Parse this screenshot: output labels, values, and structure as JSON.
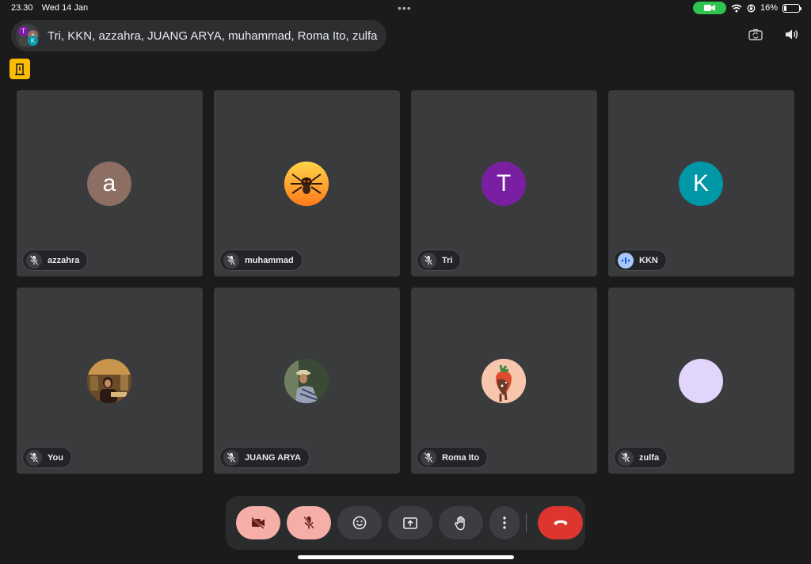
{
  "status_bar": {
    "time": "23.30",
    "date": "Wed 14 Jan",
    "battery": "16%",
    "battery_level": 0.16
  },
  "header": {
    "participants_title": "Tri, KKN, azzahra, JUANG ARYA, muhammad, Roma Ito, zulfa",
    "stack_initials": [
      "T",
      "a",
      "K"
    ],
    "icons": [
      "switch-camera-icon",
      "speaker-icon"
    ]
  },
  "tiles": [
    {
      "name": "azzahra",
      "initial": "a",
      "avatar_color": "#8d6e63",
      "avatar_type": "letter",
      "mic": "muted"
    },
    {
      "name": "muhammad",
      "initial": "",
      "avatar_color": "#f5a623",
      "avatar_type": "image",
      "mic": "muted"
    },
    {
      "name": "Tri",
      "initial": "T",
      "avatar_color": "#7b1fa2",
      "avatar_type": "letter",
      "mic": "muted"
    },
    {
      "name": "KKN",
      "initial": "K",
      "avatar_color": "#0097a7",
      "avatar_type": "letter",
      "mic": "speaking"
    },
    {
      "name": "You",
      "initial": "",
      "avatar_color": "#8a5a2b",
      "avatar_type": "image",
      "mic": "muted"
    },
    {
      "name": "JUANG ARYA",
      "initial": "",
      "avatar_color": "#4a5a3a",
      "avatar_type": "image",
      "mic": "muted"
    },
    {
      "name": "Roma Ito",
      "initial": "",
      "avatar_color": "#f4c1a8",
      "avatar_type": "image",
      "mic": "muted"
    },
    {
      "name": "zulfa",
      "initial": "",
      "avatar_color": "#e1d5fb",
      "avatar_type": "blank",
      "mic": "muted"
    }
  ],
  "controls": [
    "camera-off-icon",
    "mic-off-icon",
    "emoji-icon",
    "present-icon",
    "raise-hand-icon",
    "more-icon",
    "hang-up-icon"
  ],
  "colors": {
    "background": "#1b1b1b",
    "tile": "#3a3b3d",
    "hangup": "#dc362e",
    "off_state": "#f6aea9",
    "accent_yellow": "#fbbc04",
    "camera_pill": "#2ec44f"
  }
}
